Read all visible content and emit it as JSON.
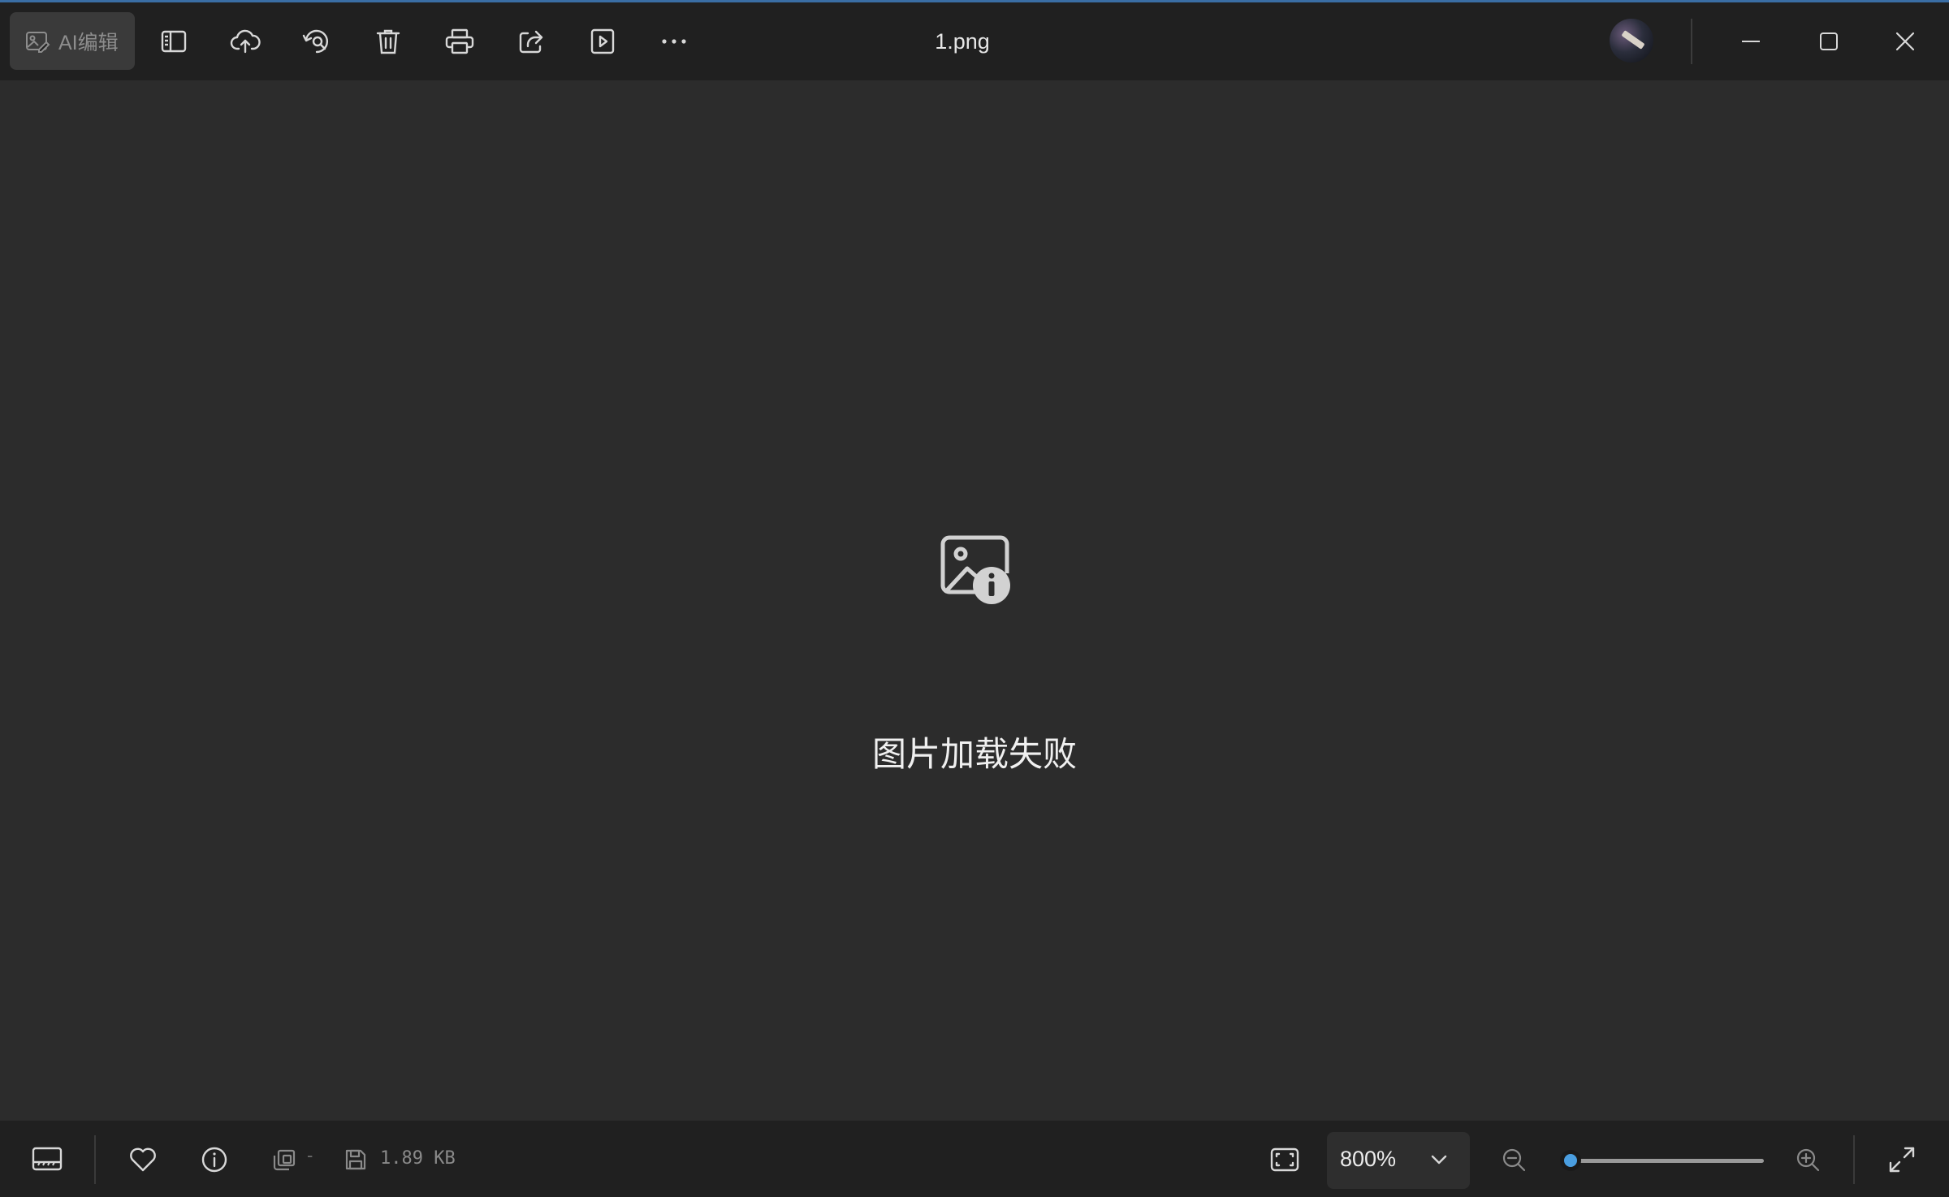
{
  "titlebar": {
    "ai_edit_label": "AI编辑",
    "file_name": "1.png",
    "tools": [
      {
        "icon": "sidebar-panel-icon"
      },
      {
        "icon": "cloud-upload-icon"
      },
      {
        "icon": "rotate-icon"
      },
      {
        "icon": "delete-trash-icon"
      },
      {
        "icon": "print-icon"
      },
      {
        "icon": "share-icon"
      },
      {
        "icon": "slideshow-play-icon"
      },
      {
        "icon": "more-ellipsis-icon"
      }
    ],
    "window_controls": [
      "minimize-icon",
      "maximize-icon",
      "close-icon"
    ]
  },
  "main": {
    "error_icon": "image-info-icon",
    "error_message": "图片加载失败"
  },
  "statusbar": {
    "filmstrip_icon": "filmstrip-icon",
    "favorite_icon": "heart-icon",
    "info_icon": "info-circle-icon",
    "copy_icon": "copy-icon",
    "copy_value": "-",
    "save_icon": "save-disk-icon",
    "file_size": "1.89 KB",
    "fit_icon": "fit-screen-icon",
    "zoom_level": "800%",
    "zoom_slider_fraction": 0.0,
    "zoom_out_icon": "zoom-out-icon",
    "zoom_in_icon": "zoom-in-icon",
    "fullscreen_icon": "fullscreen-expand-icon"
  },
  "colors": {
    "bar_background": "#202020",
    "canvas_background": "#2c2c2c",
    "slider_accent": "#4a9ee0"
  }
}
